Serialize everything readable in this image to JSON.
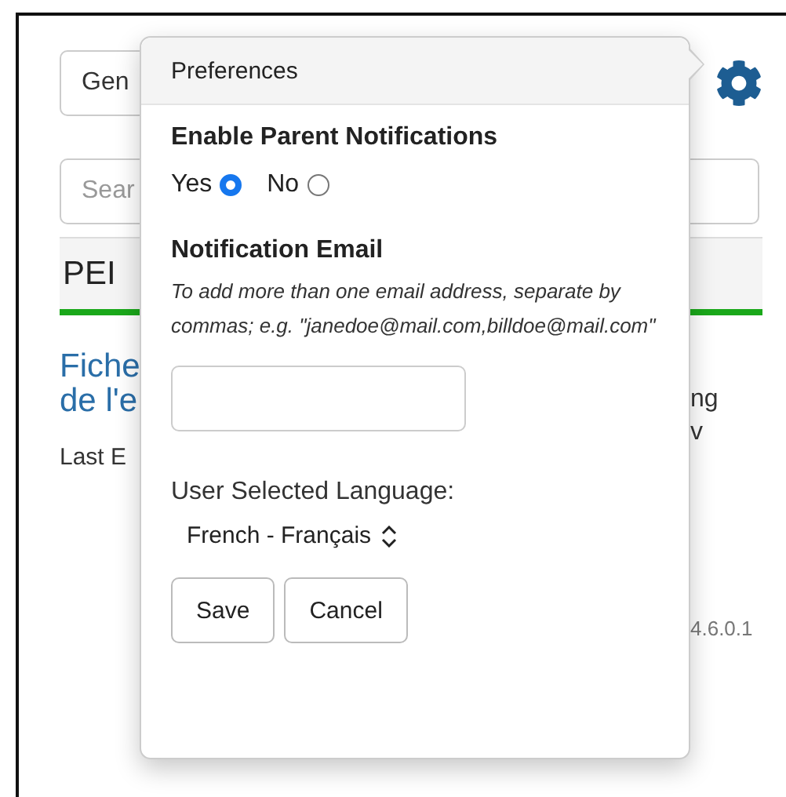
{
  "background": {
    "select": {
      "value": "Gen"
    },
    "search": {
      "placeholder": "Sear"
    },
    "section_title": "PEI",
    "link_lines": [
      "Fiche",
      "de l'e"
    ],
    "last_text": "Last E",
    "side_lines": [
      "ng",
      "v"
    ],
    "version": "4.6.0.1"
  },
  "popover": {
    "title": "Preferences",
    "notifications": {
      "label": "Enable Parent Notifications",
      "options": [
        {
          "label": "Yes",
          "selected": true
        },
        {
          "label": "No",
          "selected": false
        }
      ]
    },
    "email": {
      "label": "Notification Email",
      "hint": "To add more than one email address, separate by commas; e.g. \"janedoe@mail.com,billdoe@mail.com\""
    },
    "language": {
      "label": "User Selected Language:",
      "value": "French - Français"
    },
    "buttons": [
      "Save",
      "Cancel"
    ]
  }
}
